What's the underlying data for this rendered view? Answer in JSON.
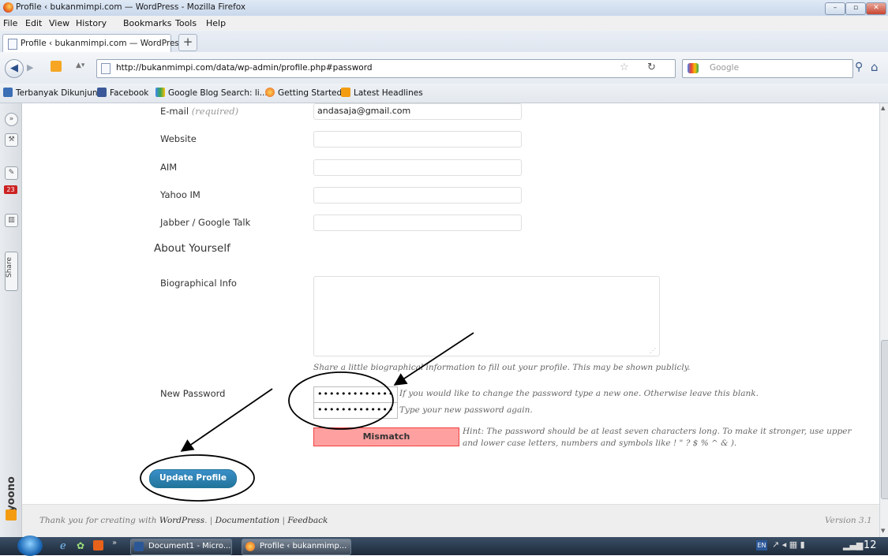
{
  "window": {
    "title": "Profile ‹ bukanmimpi.com — WordPress - Mozilla Firefox"
  },
  "menu": [
    "File",
    "Edit",
    "View",
    "History",
    "Bookmarks",
    "Tools",
    "Help"
  ],
  "tab": {
    "label": "Profile ‹ bukanmimpi.com — WordPress",
    "new_tab": "+"
  },
  "nav": {
    "url": "http://bukanmimpi.com/data/wp-admin/profile.php#password",
    "search_placeholder": "Google"
  },
  "bookmarks": [
    "Terbanyak Dikunjungi",
    "Facebook",
    "Google Blog Search: li...",
    "Getting Started",
    "Latest Headlines"
  ],
  "sidebar": {
    "badge": "23",
    "share": "Share",
    "brand": "yoono"
  },
  "form": {
    "email_label": "E-mail",
    "email_required": "(required)",
    "email_value": "andasaja@gmail.com",
    "website_label": "Website",
    "aim_label": "AIM",
    "yahoo_label": "Yahoo IM",
    "jabber_label": "Jabber / Google Talk",
    "about_heading": "About Yourself",
    "bio_label": "Biographical Info",
    "bio_desc": "Share a little biographical information to fill out your profile. This may be shown publicly.",
    "password_label": "New Password",
    "password1": "•••••••••••••",
    "password1_desc": "If you would like to change the password type a new one. Otherwise leave this blank.",
    "password2": "•••••••••••••",
    "password2_desc": "Type your new password again.",
    "strength": "Mismatch",
    "hint_line1": "Hint: The password should be at least seven characters long. To make it stronger, use upper",
    "hint_line2": "and lower case letters, numbers and symbols like ! \" ? $ % ^ & ).",
    "submit": "Update Profile"
  },
  "footer": {
    "thanks": "Thank you for creating with",
    "wordpress": "WordPress",
    "documentation": "Documentation",
    "feedback": "Feedback",
    "version": "Version 3.1"
  },
  "taskbar": {
    "doc": "Document1 - Micro...",
    "firefox": "Profile ‹ bukanmimp...",
    "lang": "EN",
    "clock": "12"
  }
}
